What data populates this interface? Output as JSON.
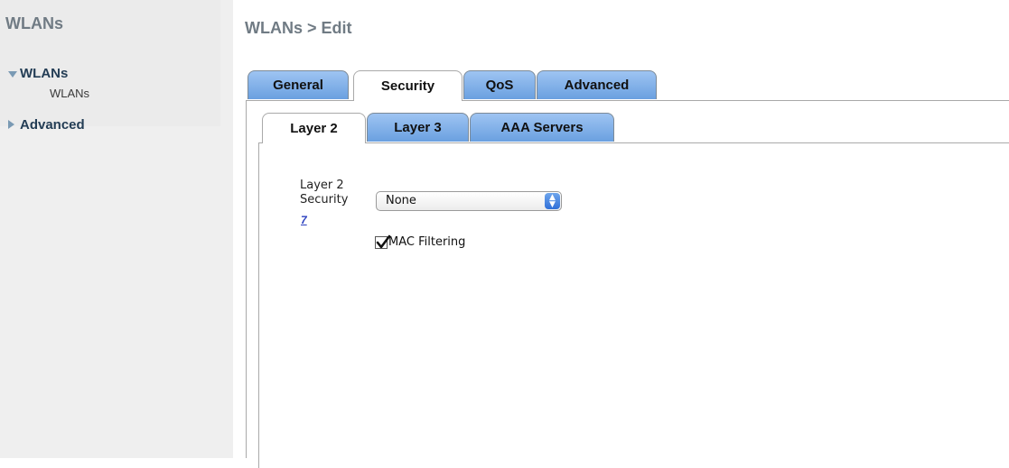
{
  "sidebar": {
    "title": "WLANs",
    "groups": [
      {
        "label": "WLANs",
        "expanded": true,
        "items": [
          {
            "label": "WLANs"
          }
        ]
      },
      {
        "label": "Advanced",
        "expanded": false
      }
    ]
  },
  "page_title": "WLANs > Edit",
  "tabs": [
    {
      "label": "General",
      "active": false
    },
    {
      "label": "Security",
      "active": true
    },
    {
      "label": "QoS",
      "active": false
    },
    {
      "label": "Advanced",
      "active": false
    }
  ],
  "subtabs": [
    {
      "label": "Layer 2",
      "active": true
    },
    {
      "label": "Layer 3",
      "active": false
    },
    {
      "label": "AAA Servers",
      "active": false
    }
  ],
  "layer2": {
    "label_line1": "Layer 2",
    "label_line2": "Security",
    "help_link": "7",
    "security_value": "None",
    "mac_filtering_label": "MAC Filtering",
    "mac_filtering_checked": true
  },
  "colors": {
    "tab_blue": "#6aa0e0",
    "sidebar_bg": "#efefef",
    "nav_text": "#233d55",
    "title_gray": "#707b84"
  }
}
